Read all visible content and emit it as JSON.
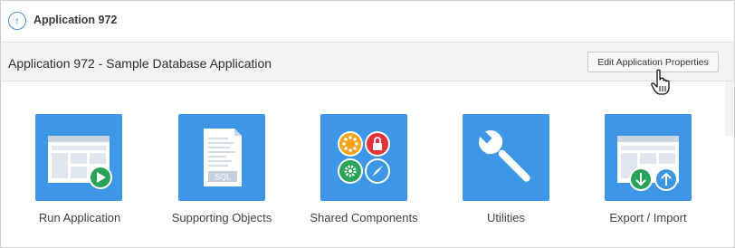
{
  "topbar": {
    "title": "Application 972",
    "up_icon": "arrow-up-circle-icon"
  },
  "header": {
    "title": "Application 972 - Sample Database Application",
    "edit_button": "Edit Application Properties"
  },
  "tiles": [
    {
      "label": "Run Application",
      "icon": "run-application-icon"
    },
    {
      "label": "Supporting Objects",
      "icon": "supporting-objects-icon",
      "badge": "SQL"
    },
    {
      "label": "Shared Components",
      "icon": "shared-components-icon"
    },
    {
      "label": "Utilities",
      "icon": "wrench-icon"
    },
    {
      "label": "Export / Import",
      "icon": "export-import-icon"
    }
  ],
  "colors": {
    "tile": "#3d97e6",
    "green": "#27a35a",
    "red": "#e2343a",
    "orange": "#f5a31a"
  }
}
